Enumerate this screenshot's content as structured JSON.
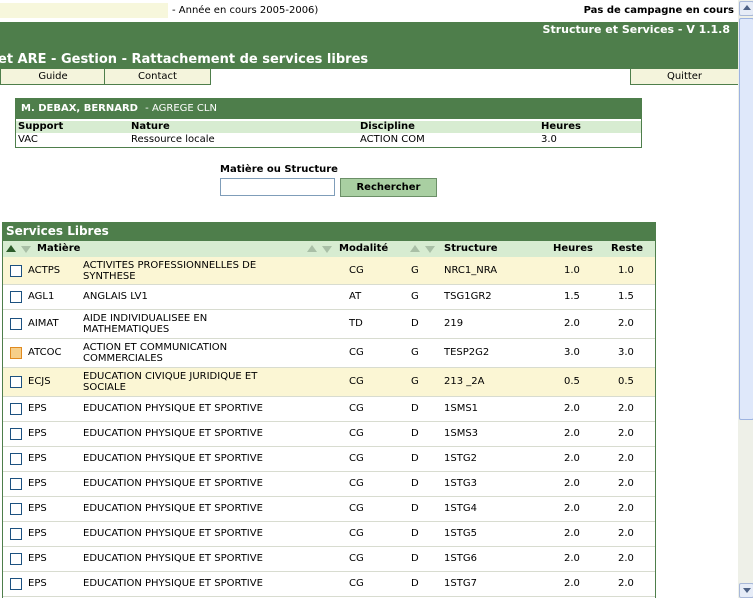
{
  "top": {
    "year": "- Année en cours 2005-2006)",
    "campaign": "Pas de campagne en cours"
  },
  "header": {
    "version": "Structure et Services - V 1.1.8",
    "title": "et ARE - Gestion - Rattachement de services libres"
  },
  "nav": {
    "guide": "Guide",
    "contact": "Contact",
    "quit": "Quitter"
  },
  "teacher": {
    "name": "M. DEBAX, BERNARD",
    "grade": "- AGREGE CLN",
    "cols": [
      "Support",
      "Nature",
      "Discipline",
      "Heures"
    ],
    "values": [
      "VAC",
      "Ressource locale",
      "ACTION COM",
      "3.0"
    ]
  },
  "search": {
    "label": "Matière ou Structure",
    "value": "",
    "button": "Rechercher"
  },
  "services": {
    "title": "Services Libres",
    "columns": {
      "matiere": "Matière",
      "modalite": "Modalité",
      "structure": "Structure",
      "heures": "Heures",
      "reste": "Reste"
    },
    "rows": [
      {
        "code": "ACTPS",
        "lib": "ACTIVITES PROFESSIONNELLES DE SYNTHESE",
        "mod": "CG",
        "type": "G",
        "struct": "NRC1_NRA",
        "h": "1.0",
        "r": "1.0",
        "hl": true,
        "orange": false
      },
      {
        "code": "AGL1",
        "lib": "ANGLAIS LV1",
        "mod": "AT",
        "type": "G",
        "struct": "TSG1GR2",
        "h": "1.5",
        "r": "1.5",
        "hl": false,
        "orange": false
      },
      {
        "code": "AIMAT",
        "lib": "AIDE INDIVIDUALISEE EN MATHEMATIQUES",
        "mod": "TD",
        "type": "D",
        "struct": "219",
        "h": "2.0",
        "r": "2.0",
        "hl": false,
        "orange": false
      },
      {
        "code": "ATCOC",
        "lib": "ACTION ET COMMUNICATION COMMERCIALES",
        "mod": "CG",
        "type": "G",
        "struct": "TESP2G2",
        "h": "3.0",
        "r": "3.0",
        "hl": false,
        "orange": true
      },
      {
        "code": "ECJS",
        "lib": "EDUCATION CIVIQUE JURIDIQUE ET SOCIALE",
        "mod": "CG",
        "type": "G",
        "struct": "213 _2A",
        "h": "0.5",
        "r": "0.5",
        "hl": true,
        "orange": false
      },
      {
        "code": "EPS",
        "lib": "EDUCATION PHYSIQUE ET SPORTIVE",
        "mod": "CG",
        "type": "D",
        "struct": "1SMS1",
        "h": "2.0",
        "r": "2.0",
        "hl": false,
        "orange": false
      },
      {
        "code": "EPS",
        "lib": "EDUCATION PHYSIQUE ET SPORTIVE",
        "mod": "CG",
        "type": "D",
        "struct": "1SMS3",
        "h": "2.0",
        "r": "2.0",
        "hl": false,
        "orange": false
      },
      {
        "code": "EPS",
        "lib": "EDUCATION PHYSIQUE ET SPORTIVE",
        "mod": "CG",
        "type": "D",
        "struct": "1STG2",
        "h": "2.0",
        "r": "2.0",
        "hl": false,
        "orange": false
      },
      {
        "code": "EPS",
        "lib": "EDUCATION PHYSIQUE ET SPORTIVE",
        "mod": "CG",
        "type": "D",
        "struct": "1STG3",
        "h": "2.0",
        "r": "2.0",
        "hl": false,
        "orange": false
      },
      {
        "code": "EPS",
        "lib": "EDUCATION PHYSIQUE ET SPORTIVE",
        "mod": "CG",
        "type": "D",
        "struct": "1STG4",
        "h": "2.0",
        "r": "2.0",
        "hl": false,
        "orange": false
      },
      {
        "code": "EPS",
        "lib": "EDUCATION PHYSIQUE ET SPORTIVE",
        "mod": "CG",
        "type": "D",
        "struct": "1STG5",
        "h": "2.0",
        "r": "2.0",
        "hl": false,
        "orange": false
      },
      {
        "code": "EPS",
        "lib": "EDUCATION PHYSIQUE ET SPORTIVE",
        "mod": "CG",
        "type": "D",
        "struct": "1STG6",
        "h": "2.0",
        "r": "2.0",
        "hl": false,
        "orange": false
      },
      {
        "code": "EPS",
        "lib": "EDUCATION PHYSIQUE ET SPORTIVE",
        "mod": "CG",
        "type": "D",
        "struct": "1STG7",
        "h": "2.0",
        "r": "2.0",
        "hl": false,
        "orange": false
      }
    ]
  }
}
